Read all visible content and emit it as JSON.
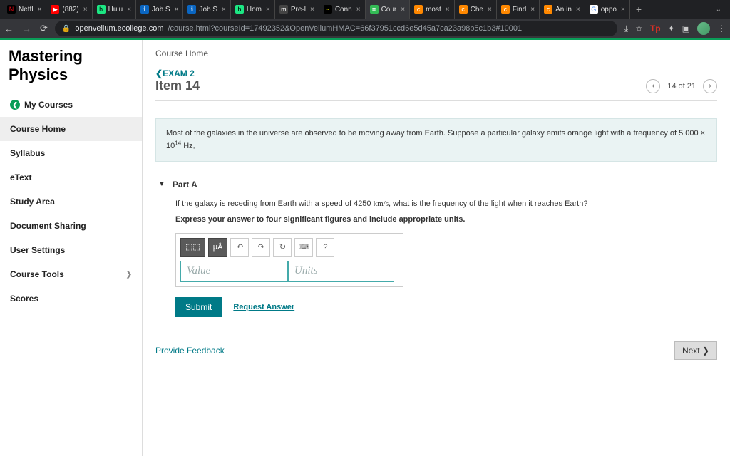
{
  "tabs": [
    {
      "favBg": "#000",
      "favTxt": "N",
      "favColor": "#e50914",
      "title": "Netfl",
      "active": false
    },
    {
      "favBg": "#f00",
      "favTxt": "▶",
      "favColor": "#fff",
      "title": "(882)",
      "active": false
    },
    {
      "favBg": "#1ce783",
      "favTxt": "h",
      "favColor": "#000",
      "title": "Hulu",
      "active": false
    },
    {
      "favBg": "#0a66c2",
      "favTxt": "ℹ",
      "favColor": "#fff",
      "title": "Job S",
      "active": false
    },
    {
      "favBg": "#0a66c2",
      "favTxt": "ℹ",
      "favColor": "#fff",
      "title": "Job S",
      "active": false
    },
    {
      "favBg": "#1ce783",
      "favTxt": "h",
      "favColor": "#000",
      "title": "Hom",
      "active": false
    },
    {
      "favBg": "#444",
      "favTxt": "m",
      "favColor": "#fff",
      "title": "Pre-l",
      "active": false
    },
    {
      "favBg": "#000",
      "favTxt": "~",
      "favColor": "#ff0",
      "title": "Conn",
      "active": false
    },
    {
      "favBg": "#3b5",
      "favTxt": "≡",
      "favColor": "#fff",
      "title": "Cour",
      "active": true
    },
    {
      "favBg": "#f80",
      "favTxt": "c",
      "favColor": "#fff",
      "title": "most",
      "active": false
    },
    {
      "favBg": "#f80",
      "favTxt": "c",
      "favColor": "#fff",
      "title": "Che",
      "active": false
    },
    {
      "favBg": "#f80",
      "favTxt": "c",
      "favColor": "#fff",
      "title": "Find",
      "active": false
    },
    {
      "favBg": "#f80",
      "favTxt": "c",
      "favColor": "#fff",
      "title": "An in",
      "active": false
    },
    {
      "favBg": "#fff",
      "favTxt": "G",
      "favColor": "#4285f4",
      "title": "oppo",
      "active": false
    }
  ],
  "url": {
    "domain": "openvellum.ecollege.com",
    "path": "/course.html?courseId=17492352&OpenVellumHMAC=66f37951ccd6e5d45a7ca23a98b5c1b3#10001"
  },
  "brand": "Mastering Physics",
  "sidebar": {
    "mycourses": "My Courses",
    "items": [
      "Course Home",
      "Syllabus",
      "eText",
      "Study Area",
      "Document Sharing",
      "User Settings",
      "Course Tools",
      "Scores"
    ],
    "activeIndex": 0,
    "expandableIndex": 6
  },
  "crumb": "Course Home",
  "examLink": "EXAM 2",
  "itemTitle": "Item 14",
  "pager": {
    "pos": "14 of 21"
  },
  "context": {
    "pre": "Most of the galaxies in the universe are observed to be moving away from Earth. Suppose a particular galaxy emits orange light with a frequency of ",
    "coef": "5.000 × 10",
    "exp": "14",
    "unit": " Hz",
    "post": "."
  },
  "part": {
    "label": "Part A"
  },
  "question": {
    "pre": "If the galaxy is receding from Earth with a speed of 4250 ",
    "speedUnit": "km/s",
    "post": ", what is the frequency of the light when it reaches Earth?",
    "instruction": "Express your answer to four significant figures and include appropriate units."
  },
  "answer": {
    "valuePlaceholder": "Value",
    "unitsPlaceholder": "Units"
  },
  "toolbar": {
    "templates": "⬚⬚",
    "symbols": "μÅ",
    "undo": "↶",
    "redo": "↷",
    "reset": "↻",
    "keyboard": "⌨",
    "help": "?"
  },
  "buttons": {
    "submit": "Submit",
    "request": "Request Answer",
    "feedback": "Provide Feedback",
    "next": "Next ❯"
  }
}
